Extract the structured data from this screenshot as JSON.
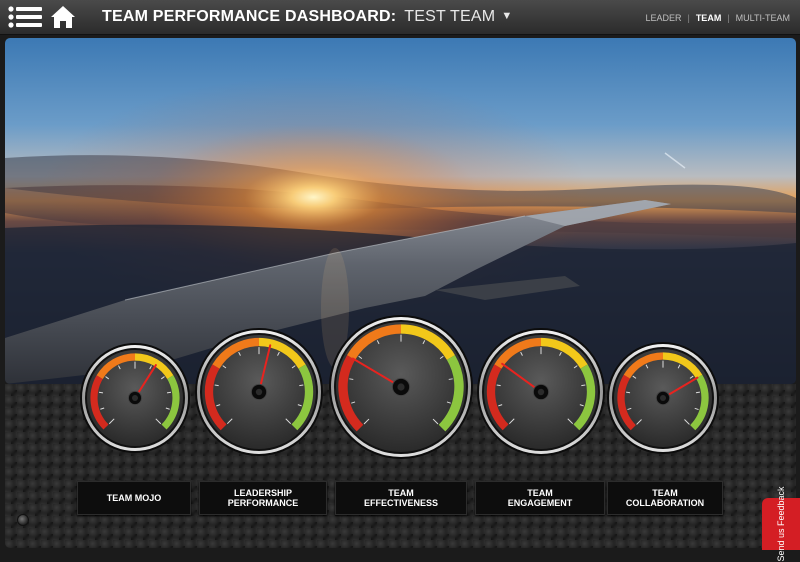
{
  "header": {
    "title": "TEAM PERFORMANCE DASHBOARD:",
    "team_name": "TEST TEAM",
    "views": [
      {
        "label": "LEADER",
        "active": false
      },
      {
        "label": "TEAM",
        "active": true
      },
      {
        "label": "MULTI-TEAM",
        "active": false
      }
    ]
  },
  "colors": {
    "red": "#d42a1e",
    "orange": "#f07a1a",
    "yellow": "#f2c81a",
    "green": "#8cc63f",
    "needle": "#e8231f"
  },
  "gauges": [
    {
      "label": "TEAM MOJO",
      "value": 0.62
    },
    {
      "label": "LEADERSHIP PERFORMANCE",
      "value": 0.55
    },
    {
      "label": "TEAM EFFECTIVENESS",
      "value": 0.28
    },
    {
      "label": "TEAM ENGAGEMENT",
      "value": 0.3
    },
    {
      "label": "TEAM COLLABORATION",
      "value": 0.72
    }
  ],
  "feedback": {
    "label": "Send us Feedback"
  }
}
